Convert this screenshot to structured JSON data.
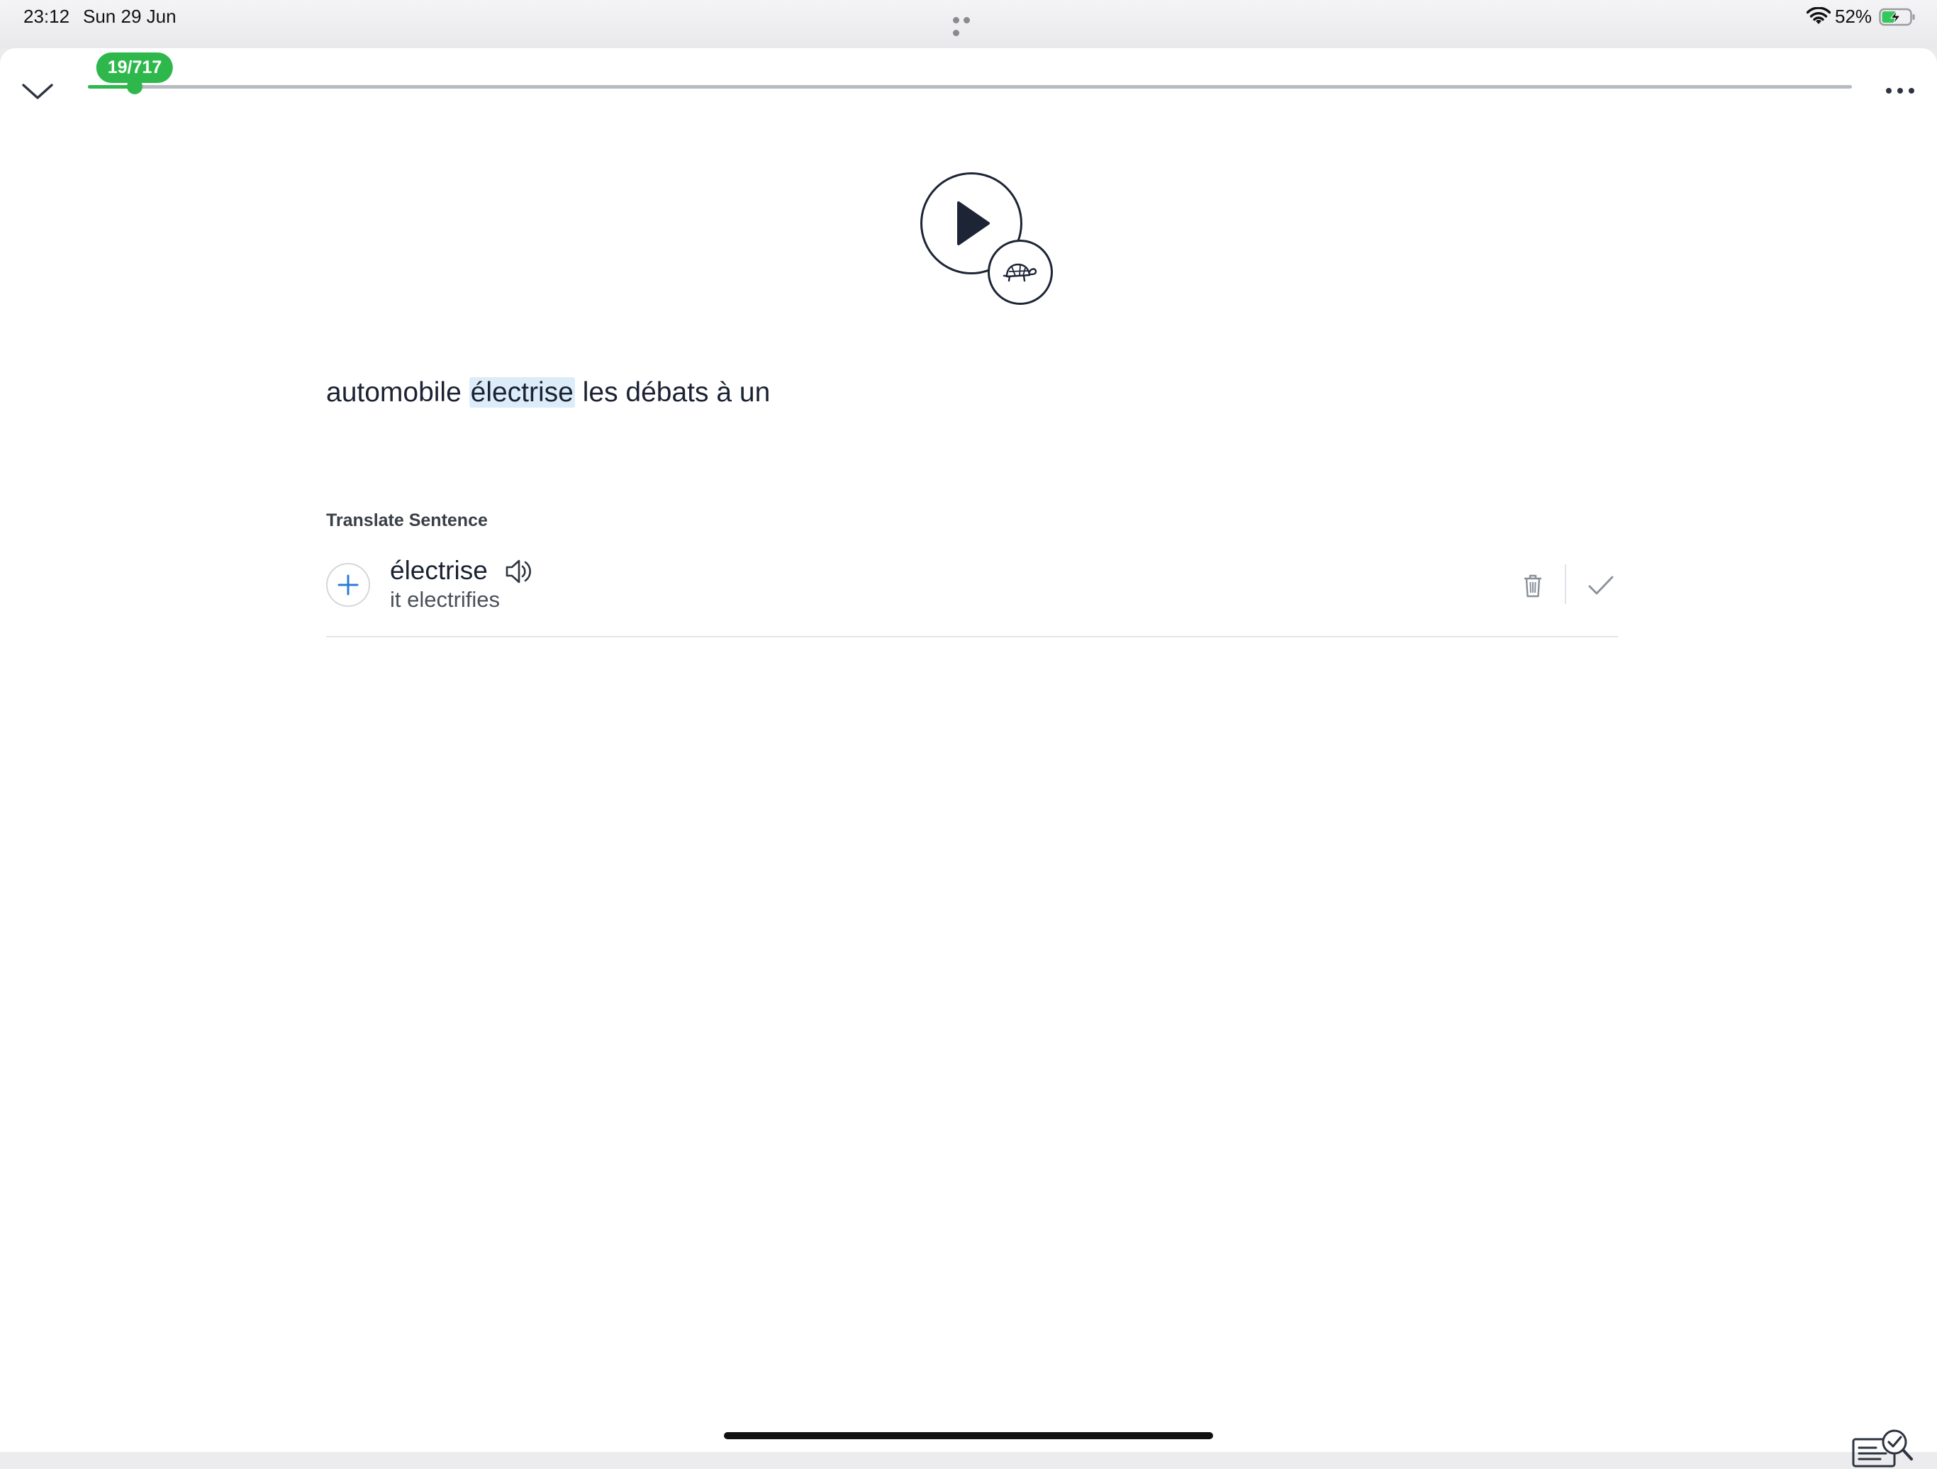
{
  "status_bar": {
    "time": "23:12",
    "date": "Sun 29 Jun",
    "battery_percent": "52%",
    "battery_level": 0.52,
    "charging": true
  },
  "progress": {
    "label": "19/717",
    "current": 19,
    "total": 717,
    "fill_color": "#2eb84b"
  },
  "sentence": {
    "words": [
      "automobile",
      "électrise",
      "les",
      "débats",
      "à",
      "un"
    ],
    "highlighted": "électrise"
  },
  "section": {
    "title": "Translate Sentence"
  },
  "term": {
    "word": "électrise",
    "translation": "it electrifies"
  },
  "icons": {
    "collapse": "chevron-down-icon",
    "more": "more-dots-icon",
    "play": "play-icon",
    "slow": "turtle-icon",
    "add": "plus-icon",
    "speaker": "speaker-icon",
    "delete": "trash-icon",
    "confirm": "check-icon",
    "review": "review-check-icon"
  },
  "colors": {
    "accent_green": "#2eb84b",
    "highlight_blue": "#dcecf9",
    "add_blue": "#2a7bd6",
    "text_dark": "#1a2233"
  }
}
